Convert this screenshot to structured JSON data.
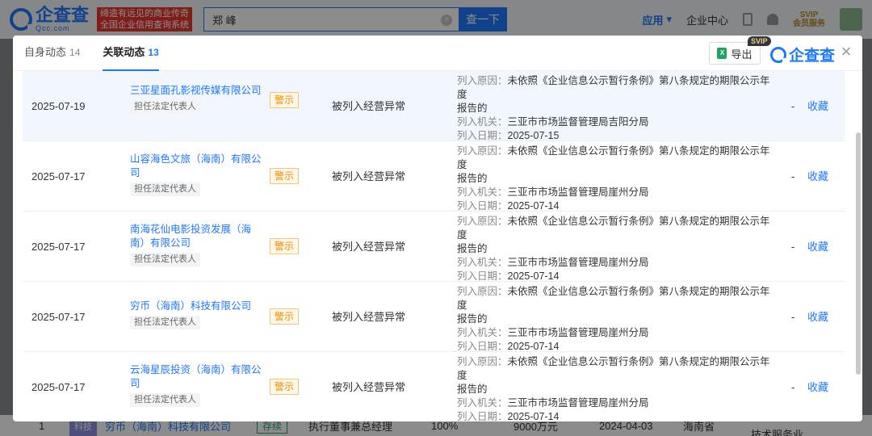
{
  "topbar": {
    "logo_text": "企查查",
    "logo_sub": "Qcc.com",
    "slogan_line1": "缔造有远见的商业传奇",
    "slogan_line2": "全国企业信用查询系统",
    "search_value": "郑  峰",
    "search_clear": "×",
    "search_button": "查一下",
    "app_label": "应用",
    "enterprise_center": "企业中心",
    "svip_label": "SVIP",
    "member_service": "会员服务"
  },
  "background_row": {
    "index": "1",
    "company": "穷币（海南）科技有限公司",
    "status": "存续",
    "position": "执行董事兼总经理",
    "ratio": "100%",
    "capital": "9000万元",
    "date": "2024-04-03",
    "province": "海南省",
    "industry": "技术服务业",
    "avatar_text": "科技"
  },
  "modal": {
    "tabs": [
      {
        "label": "自身动态",
        "count": "14"
      },
      {
        "label": "关联动态",
        "count": "13"
      }
    ],
    "export_label": "导出",
    "export_icon": "excel-icon",
    "svip_tag": "SVIP",
    "logo_text": "企查查",
    "close_symbol": "×",
    "rows": [
      {
        "date": "2025-07-19",
        "company_line1": "三亚星面孔影视传媒有限公司",
        "company_line2": "",
        "role": "担任法定代表人",
        "tag": "警示",
        "event": "被列入经营异常",
        "reason_label": "列入原因：",
        "reason": "未依照《企业信息公示暂行条例》第八条规定的期限公示年度",
        "reason_cont": "报告的",
        "org_label": "列入机关：",
        "org": "三亚市市场监督管理局吉阳分局",
        "date_label": "列入日期：",
        "list_date": "2025-07-15",
        "dash": "-",
        "fav": "收藏"
      },
      {
        "date": "2025-07-17",
        "company_line1": "山容海色文旅（海南）有限公",
        "company_line2": "司",
        "role": "担任法定代表人",
        "tag": "警示",
        "event": "被列入经营异常",
        "reason_label": "列入原因：",
        "reason": "未依照《企业信息公示暂行条例》第八条规定的期限公示年度",
        "reason_cont": "报告的",
        "org_label": "列入机关：",
        "org": "三亚市市场监督管理局崖州分局",
        "date_label": "列入日期：",
        "list_date": "2025-07-14",
        "dash": "-",
        "fav": "收藏"
      },
      {
        "date": "2025-07-17",
        "company_line1": "南海花仙电影投资发展（海",
        "company_line2": "南）有限公司",
        "role": "担任法定代表人",
        "tag": "警示",
        "event": "被列入经营异常",
        "reason_label": "列入原因：",
        "reason": "未依照《企业信息公示暂行条例》第八条规定的期限公示年度",
        "reason_cont": "报告的",
        "org_label": "列入机关：",
        "org": "三亚市市场监督管理局崖州分局",
        "date_label": "列入日期：",
        "list_date": "2025-07-14",
        "dash": "-",
        "fav": "收藏"
      },
      {
        "date": "2025-07-17",
        "company_line1": "穷币（海南）科技有限公司",
        "company_line2": "",
        "role": "担任法定代表人",
        "tag": "警示",
        "event": "被列入经营异常",
        "reason_label": "列入原因：",
        "reason": "未依照《企业信息公示暂行条例》第八条规定的期限公示年度",
        "reason_cont": "报告的",
        "org_label": "列入机关：",
        "org": "三亚市市场监督管理局崖州分局",
        "date_label": "列入日期：",
        "list_date": "2025-07-14",
        "dash": "-",
        "fav": "收藏"
      },
      {
        "date": "2025-07-17",
        "company_line1": "云海星辰投资（海南）有限公",
        "company_line2": "司",
        "role": "担任法定代表人",
        "tag": "警示",
        "event": "被列入经营异常",
        "reason_label": "列入原因：",
        "reason": "未依照《企业信息公示暂行条例》第八条规定的期限公示年度",
        "reason_cont": "报告的",
        "org_label": "列入机关：",
        "org": "三亚市市场监督管理局崖州分局",
        "date_label": "列入日期：",
        "list_date": "2025-07-14",
        "dash": "-",
        "fav": "收藏"
      }
    ]
  }
}
